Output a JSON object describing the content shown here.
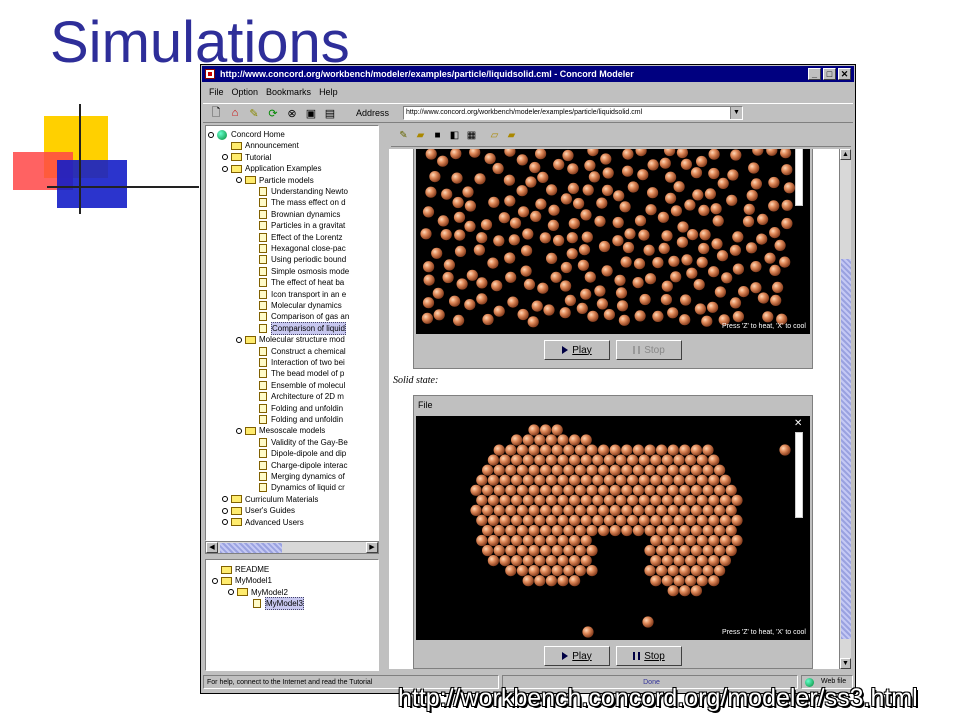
{
  "slide": {
    "title": "Simulations",
    "url_caption": "http://workbench.concord.org/modeler/ss3.html"
  },
  "window": {
    "title": "http://www.concord.org/workbench/modeler/examples/particle/liquidsolid.cml - Concord Modeler",
    "controls": [
      "_",
      "□",
      "✕"
    ],
    "menu": [
      "File",
      "Option",
      "Bookmarks",
      "Help"
    ],
    "address_label": "Address",
    "address_value": "http://www.concord.org/workbench/modeler/examples/particle/liquidsolid.cml"
  },
  "tree": {
    "rows": [
      {
        "label": "Concord Home",
        "indent": 0,
        "icon": "globe-icon",
        "key": true
      },
      {
        "label": "Announcement",
        "indent": 1,
        "icon": "folder-icon",
        "key": false
      },
      {
        "label": "Tutorial",
        "indent": 1,
        "icon": "folder-icon",
        "key": true
      },
      {
        "label": "Application Examples",
        "indent": 1,
        "icon": "folder-icon",
        "key": true
      },
      {
        "label": "Particle models",
        "indent": 2,
        "icon": "folder-icon",
        "key": true
      },
      {
        "label": "Understanding Newto",
        "indent": 3,
        "icon": "page-icon",
        "key": false
      },
      {
        "label": "The mass effect on d",
        "indent": 3,
        "icon": "page-icon",
        "key": false
      },
      {
        "label": "Brownian dynamics",
        "indent": 3,
        "icon": "page-icon",
        "key": false
      },
      {
        "label": "Particles in a gravitat",
        "indent": 3,
        "icon": "page-icon",
        "key": false
      },
      {
        "label": "Effect of the Lorentz",
        "indent": 3,
        "icon": "page-icon",
        "key": false
      },
      {
        "label": "Hexagonal close-pac",
        "indent": 3,
        "icon": "page-icon",
        "key": false
      },
      {
        "label": "Using periodic bound",
        "indent": 3,
        "icon": "page-icon",
        "key": false
      },
      {
        "label": "Simple osmosis mode",
        "indent": 3,
        "icon": "page-icon",
        "key": false
      },
      {
        "label": "The effect of heat ba",
        "indent": 3,
        "icon": "page-icon",
        "key": false
      },
      {
        "label": "Icon transport in an e",
        "indent": 3,
        "icon": "page-icon",
        "key": false
      },
      {
        "label": "Molecular dynamics",
        "indent": 3,
        "icon": "page-icon",
        "key": false
      },
      {
        "label": "Comparison of gas an",
        "indent": 3,
        "icon": "page-icon",
        "key": false
      },
      {
        "label": "Comparison of liquid",
        "indent": 3,
        "icon": "page-icon",
        "key": false,
        "selected": true
      },
      {
        "label": "Molecular structure mod",
        "indent": 2,
        "icon": "folder-icon",
        "key": true
      },
      {
        "label": "Construct a chemical",
        "indent": 3,
        "icon": "page-icon",
        "key": false
      },
      {
        "label": "Interaction of two bei",
        "indent": 3,
        "icon": "page-icon",
        "key": false
      },
      {
        "label": "The bead model of p",
        "indent": 3,
        "icon": "page-icon",
        "key": false
      },
      {
        "label": "Ensemble of molecul",
        "indent": 3,
        "icon": "page-icon",
        "key": false
      },
      {
        "label": "Architecture of 2D m",
        "indent": 3,
        "icon": "page-icon",
        "key": false
      },
      {
        "label": "Folding and unfoldin",
        "indent": 3,
        "icon": "page-icon",
        "key": false
      },
      {
        "label": "Folding and unfoldin",
        "indent": 3,
        "icon": "page-icon",
        "key": false
      },
      {
        "label": "Mesoscale models",
        "indent": 2,
        "icon": "folder-icon",
        "key": true
      },
      {
        "label": "Validity of the Gay-Be",
        "indent": 3,
        "icon": "page-icon",
        "key": false
      },
      {
        "label": "Dipole-dipole and dip",
        "indent": 3,
        "icon": "page-icon",
        "key": false
      },
      {
        "label": "Charge-dipole interac",
        "indent": 3,
        "icon": "page-icon",
        "key": false
      },
      {
        "label": "Merging dynamics of",
        "indent": 3,
        "icon": "page-icon",
        "key": false
      },
      {
        "label": "Dynamics of liquid cr",
        "indent": 3,
        "icon": "page-icon",
        "key": false
      },
      {
        "label": "Curriculum Materials",
        "indent": 1,
        "icon": "folder-icon",
        "key": true
      },
      {
        "label": "User's Guides",
        "indent": 1,
        "icon": "folder-icon",
        "key": true
      },
      {
        "label": "Advanced Users",
        "indent": 1,
        "icon": "folder-icon",
        "key": true
      }
    ]
  },
  "models": {
    "rows": [
      {
        "label": "README",
        "indent": 0,
        "key": false
      },
      {
        "label": "MyModel1",
        "indent": 0,
        "key": true
      },
      {
        "label": "MyModel2",
        "indent": 1,
        "key": true
      },
      {
        "label": "MyModel3",
        "indent": 2,
        "key": false,
        "selected": true
      }
    ]
  },
  "sim1": {
    "hint": "Press 'Z' to heat, 'X' to cool",
    "play_label": "Play",
    "stop_label": "Stop"
  },
  "solid_label": "Solid state:",
  "sim2": {
    "file_menu": "File",
    "close": "✕",
    "hint": "Press 'Z' to heat, 'X' to cool",
    "play_label": "Play",
    "stop_label": "Stop"
  },
  "status": {
    "message": "For help, connect to the Internet and read the Tutorial",
    "done": "Done",
    "zone": "Web file"
  }
}
